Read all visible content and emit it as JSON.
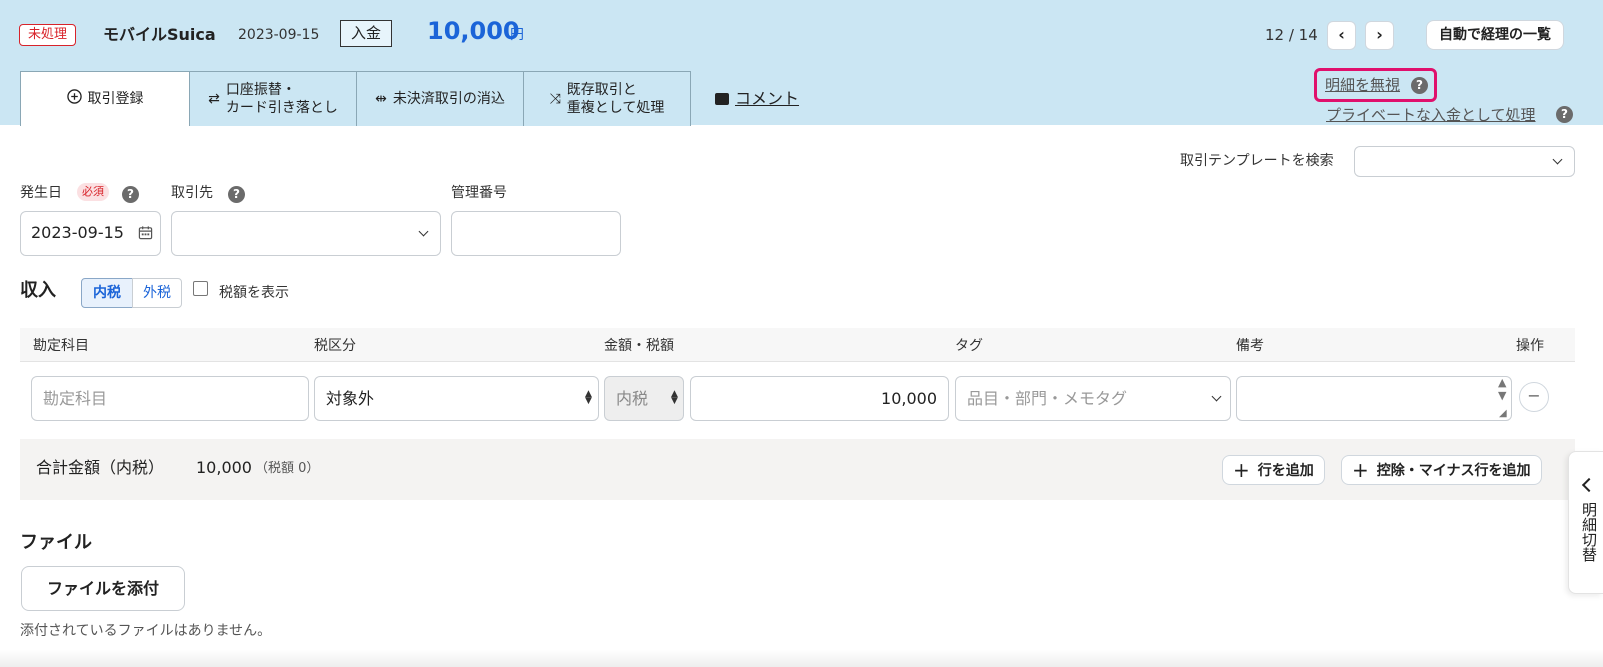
{
  "header": {
    "status_badge": "未処理",
    "account_name": "モバイルSuica",
    "date": "2023-09-15",
    "type_label": "入金",
    "amount": "10,000",
    "amount_unit": "円",
    "pager_text": "12 / 14",
    "prev_icon": "chevron-left-icon",
    "next_icon": "chevron-right-icon",
    "auto_list_button": "自動で経理の一覧"
  },
  "tabs": [
    {
      "label": "取引登録",
      "icon": "plus-circle-icon",
      "active": true
    },
    {
      "label_line1": "口座振替・",
      "label_line2": "カード引き落とし",
      "icon": "swap-arrows-icon"
    },
    {
      "label": "未決済取引の消込",
      "icon": "merge-icon"
    },
    {
      "label_line1": "既存取引と",
      "label_line2": "重複として処理",
      "icon": "shuffle-icon"
    }
  ],
  "comment_link": "コメント",
  "ignore_link": "明細を無視",
  "private_link": "プライベートな入金として処理",
  "highlight_color": "#e0106c",
  "template_search": {
    "label": "取引テンプレートを検索",
    "value": ""
  },
  "form": {
    "date_label": "発生日",
    "required_badge": "必須",
    "date_value": "2023-09-15",
    "partner_label": "取引先",
    "partner_value": "",
    "mgmt_label": "管理番号",
    "mgmt_value": ""
  },
  "income": {
    "title": "収入",
    "tax_in": "内税",
    "tax_out": "外税",
    "show_tax_label": "税額を表示",
    "show_tax_checked": false
  },
  "table": {
    "headers": [
      "勘定科目",
      "税区分",
      "金額・税額",
      "タグ",
      "備考",
      "操作"
    ],
    "row": {
      "account_placeholder": "勘定科目",
      "tax_category": "対象外",
      "tax_mode": "内税",
      "amount": "10,000",
      "tag_placeholder": "品目・部門・メモタグ",
      "note": ""
    }
  },
  "total": {
    "label": "合計金額（内税）",
    "value": "10,000",
    "tax": "（税額 0）",
    "add_row": "行を追加",
    "add_minus_row": "控除・マイナス行を追加"
  },
  "side_tab": "明細切替",
  "files": {
    "title": "ファイル",
    "attach_button": "ファイルを添付",
    "empty_note": "添付されているファイルはありません。"
  }
}
